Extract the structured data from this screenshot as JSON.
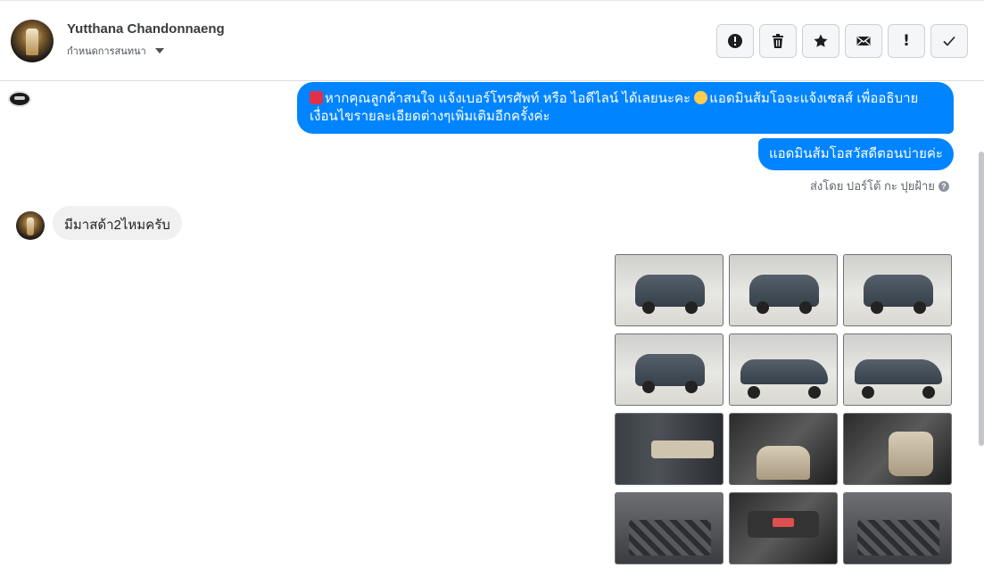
{
  "header": {
    "contact_name": "Yutthana Chandonnaeng",
    "assign_label": "กำหนดการสนทนา",
    "toolbar": [
      {
        "name": "spam-button",
        "icon": "alert-circle-icon"
      },
      {
        "name": "delete-button",
        "icon": "trash-icon"
      },
      {
        "name": "star-button",
        "icon": "star-icon"
      },
      {
        "name": "mark-unread-button",
        "icon": "envelope-icon"
      },
      {
        "name": "follow-up-button",
        "icon": "exclamation-icon",
        "glyph": "!"
      },
      {
        "name": "mark-done-button",
        "icon": "check-icon"
      }
    ]
  },
  "messages": {
    "outgoing_1": "หากคุณลูกค้าสนใจ แจ้งเบอร์โทรศัพท์ หรือ ไอดีไลน์  ได้เลยนะคะ ",
    "outgoing_1b": "แอดมินส้มโอจะแจ้งเซลส์   เพื่ออธิบายเงื่อนไขรายละเอียดต่างๆเพิ่มเติมอีกครั้งค่ะ",
    "outgoing_2": "แอดมินส้มโอสวัสดีตอนบ่ายค่ะ",
    "sent_by": "ส่งโดย ปอร์โต้ กะ ปุยฝ้าย",
    "incoming_1": "มีมาสด้า2ไหมครับ"
  },
  "photos": [
    {
      "kind": "exterior-front",
      "desc": "car-front"
    },
    {
      "kind": "exterior-front-angle",
      "desc": "car-front-angle"
    },
    {
      "kind": "exterior-rear-angle",
      "desc": "car-rear-angle"
    },
    {
      "kind": "exterior-rear",
      "desc": "car-rear"
    },
    {
      "kind": "exterior-side",
      "desc": "car-side"
    },
    {
      "kind": "exterior-side-front",
      "desc": "car-side-front"
    },
    {
      "kind": "interior-door",
      "desc": "door-panel"
    },
    {
      "kind": "interior-seats",
      "desc": "front-seats"
    },
    {
      "kind": "interior-gear",
      "desc": "gear-console"
    },
    {
      "kind": "engine-bay",
      "desc": "engine-bay"
    },
    {
      "kind": "interior-dash",
      "desc": "dashboard"
    },
    {
      "kind": "engine-detail",
      "desc": "engine-detail"
    }
  ],
  "colors": {
    "outgoing_bubble": "#0084ff",
    "incoming_bubble": "#f1f0f0"
  }
}
